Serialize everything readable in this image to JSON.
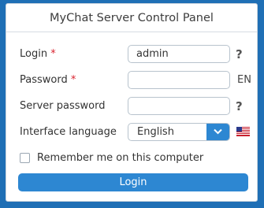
{
  "panel": {
    "title": "MyChat Server Control Panel"
  },
  "form": {
    "login": {
      "label": "Login",
      "required_mark": "*",
      "value": "admin",
      "help": "?"
    },
    "password": {
      "label": "Password",
      "required_mark": "*",
      "value": "",
      "layout_indicator": "EN"
    },
    "server_password": {
      "label": "Server password",
      "value": "",
      "help": "?"
    },
    "interface_language": {
      "label": "Interface language",
      "selected": "English",
      "flag_icon": "us-flag-icon"
    },
    "remember": {
      "label": "Remember me on this computer",
      "checked": false
    },
    "submit_label": "Login"
  },
  "colors": {
    "background": "#1f6fb5",
    "accent": "#2d87d2",
    "required": "#d9232f"
  }
}
